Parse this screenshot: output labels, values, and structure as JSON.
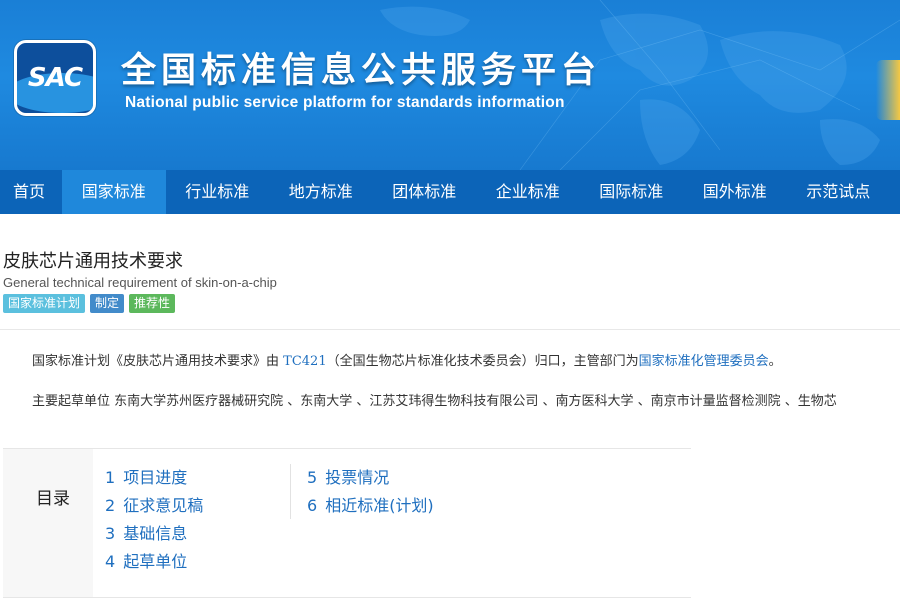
{
  "banner": {
    "logo_text": "SAC",
    "title": "全国标准信息公共服务平台",
    "subtitle": "National public service platform  for standards information"
  },
  "nav": {
    "items": [
      {
        "label": "首页"
      },
      {
        "label": "国家标准"
      },
      {
        "label": "行业标准"
      },
      {
        "label": "地方标准"
      },
      {
        "label": "团体标准"
      },
      {
        "label": "企业标准"
      },
      {
        "label": "国际标准"
      },
      {
        "label": "国外标准"
      },
      {
        "label": "示范试点"
      }
    ],
    "active": "国家标准"
  },
  "standard": {
    "title_cn": "皮肤芯片通用技术要求",
    "title_en": "General technical requirement of skin-on-a-chip",
    "tags": [
      "国家标准计划",
      "制定",
      "推荐性"
    ]
  },
  "description": {
    "line1_prefix": "国家标准计划《皮肤芯片通用技术要求》由",
    "tc_code": "TC421",
    "line1_mid": "（全国生物芯片标准化技术委员会）归口，主管部门为",
    "authority": "国家标准化管理委员会",
    "line1_suffix": "。",
    "line2": "主要起草单位 东南大学苏州医疗器械研究院 、东南大学 、江苏艾玮得生物科技有限公司 、南方医科大学 、南京市计量监督检测院 、生物芯"
  },
  "toc": {
    "label": "目录",
    "items": [
      {
        "num": "1",
        "label": "项目进度"
      },
      {
        "num": "2",
        "label": "征求意见稿"
      },
      {
        "num": "3",
        "label": "基础信息"
      },
      {
        "num": "4",
        "label": "起草单位"
      },
      {
        "num": "5",
        "label": "投票情况"
      },
      {
        "num": "6",
        "label": "相近标准(计划)"
      }
    ]
  },
  "colors": {
    "nav_bg": "#0c64b8",
    "nav_active": "#1f88db",
    "banner_blue": "#1f8ae0",
    "link": "#1f6fbf",
    "tag_plan": "#5bc0de",
    "tag_type": "#428bca",
    "tag_rec": "#5cb85c"
  }
}
